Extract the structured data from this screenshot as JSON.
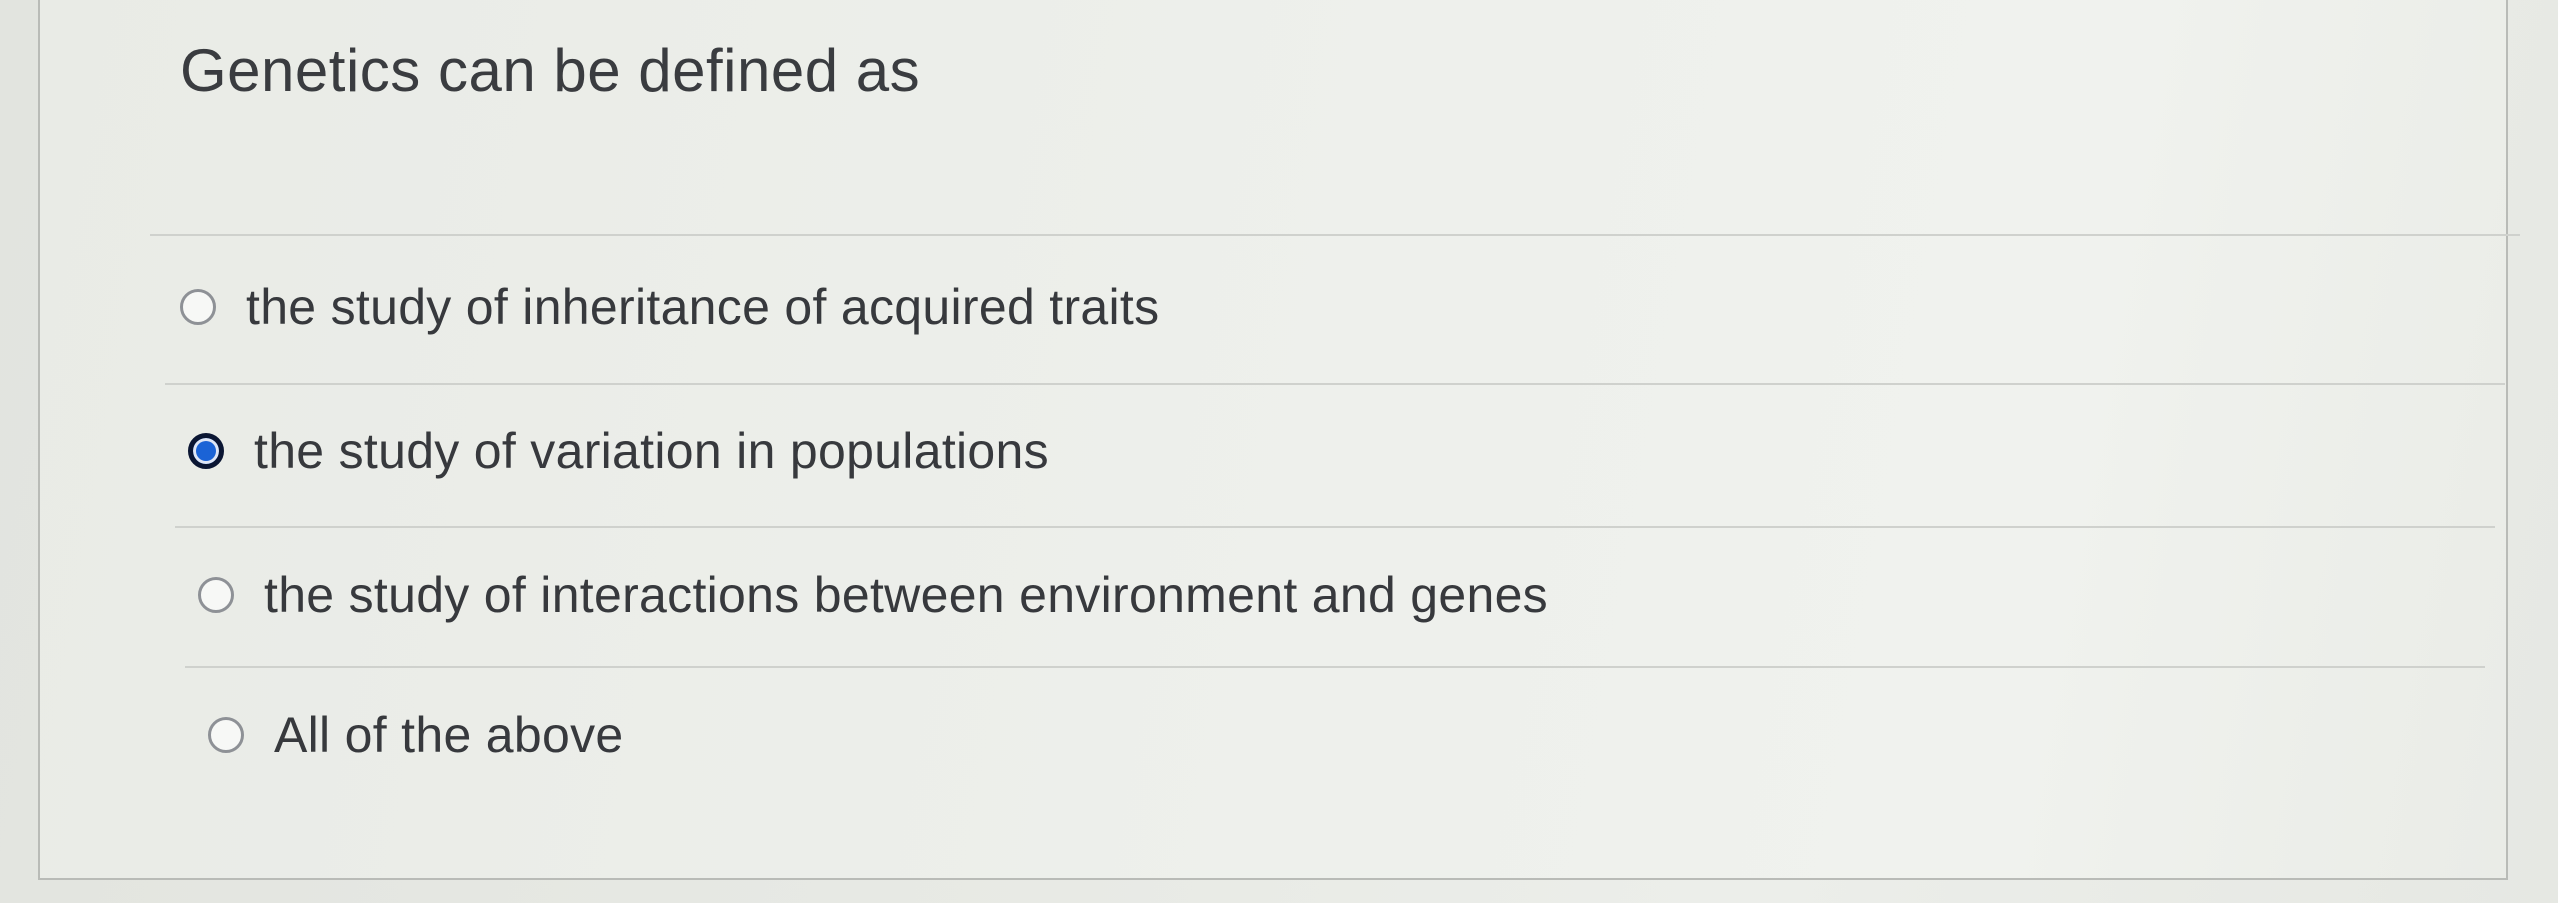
{
  "question": {
    "text": "Genetics can be defined as"
  },
  "options": [
    {
      "label": "the study of inheritance of acquired traits",
      "selected": false
    },
    {
      "label": "the study of variation in populations",
      "selected": true
    },
    {
      "label": "the study of interactions between environment and genes",
      "selected": false
    },
    {
      "label": "All of the above",
      "selected": false
    }
  ],
  "colors": {
    "selected_radio_fill": "#1b63d6",
    "selected_radio_ring": "#0b1633",
    "text": "#37393d"
  },
  "icons": {
    "cursor": "pointer-cursor-icon"
  }
}
